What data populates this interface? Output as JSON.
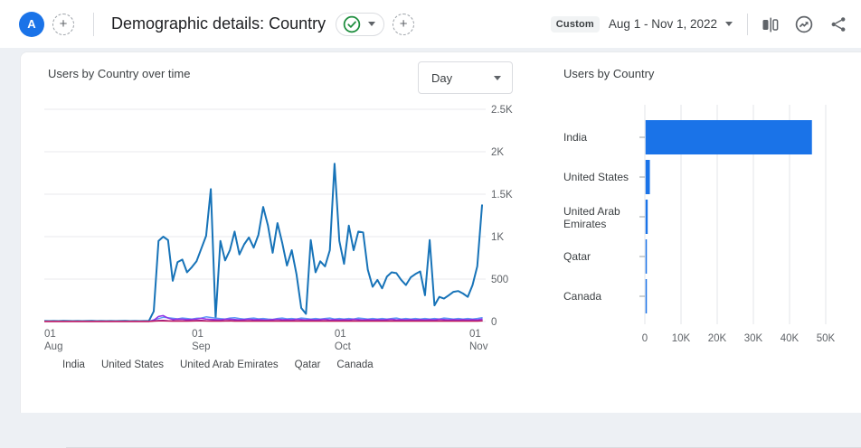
{
  "header": {
    "avatar_letter": "A",
    "add_comparison_label": "+",
    "title": "Demographic details: Country",
    "add_metric_label": "+",
    "date_range_type": "Custom",
    "date_range": "Aug 1 - Nov 1, 2022"
  },
  "left_panel": {
    "title": "Users by Country over time",
    "granularity_selected": "Day"
  },
  "right_panel": {
    "title": "Users by Country"
  },
  "colors": {
    "accent_blue": "#1a73e8",
    "check_green": "#1e8e3e",
    "grid": "#e8eaed",
    "axis_text": "#5f6368"
  },
  "chart_data": [
    {
      "type": "line",
      "title": "Users by Country over time",
      "granularity": "Day",
      "grid": true,
      "legend_position": "bottom",
      "ylim": [
        0,
        2500
      ],
      "y_ticks": [
        0,
        500,
        1000,
        1500,
        2000,
        2500
      ],
      "y_tick_labels": [
        "0",
        "500",
        "1K",
        "1.5K",
        "2K",
        "2.5K"
      ],
      "x_range": [
        "Aug 1, 2022",
        "Nov 1, 2022"
      ],
      "x_ticks": [
        {
          "day": 0,
          "top": "01",
          "bottom": "Aug"
        },
        {
          "day": 31,
          "top": "01",
          "bottom": "Sep"
        },
        {
          "day": 61,
          "top": "01",
          "bottom": "Oct"
        },
        {
          "day": 92,
          "top": "01",
          "bottom": "Nov"
        }
      ],
      "series": [
        {
          "name": "India",
          "color": "#1773b8",
          "values": [
            6,
            5,
            6,
            5,
            7,
            6,
            5,
            6,
            5,
            6,
            7,
            5,
            6,
            5,
            6,
            5,
            6,
            7,
            5,
            6,
            5,
            6,
            9,
            120,
            950,
            1000,
            960,
            480,
            700,
            730,
            580,
            640,
            710,
            860,
            1010,
            1560,
            40,
            950,
            720,
            840,
            1060,
            790,
            910,
            990,
            870,
            1020,
            1350,
            1130,
            810,
            1160,
            930,
            660,
            840,
            560,
            160,
            90,
            960,
            580,
            710,
            650,
            840,
            1860,
            950,
            680,
            1130,
            840,
            1060,
            1050,
            610,
            410,
            490,
            390,
            530,
            580,
            570,
            490,
            430,
            520,
            560,
            590,
            310,
            960,
            190,
            290,
            270,
            310,
            350,
            360,
            330,
            290,
            430,
            650,
            1370
          ]
        },
        {
          "name": "United States",
          "color": "#5e97f6",
          "values": [
            2,
            2,
            2,
            2,
            2,
            2,
            2,
            2,
            2,
            2,
            2,
            2,
            2,
            2,
            2,
            2,
            2,
            2,
            2,
            2,
            2,
            2,
            2,
            20,
            35,
            50,
            45,
            38,
            32,
            42,
            36,
            30,
            38,
            42,
            55,
            48,
            40,
            34,
            30,
            42,
            46,
            36,
            30,
            36,
            42,
            32,
            36,
            30,
            26,
            36,
            42,
            32,
            36,
            30,
            42,
            36,
            30,
            36,
            30,
            36,
            42,
            30,
            36,
            30,
            36,
            30,
            42,
            36,
            30,
            36,
            30,
            36,
            30,
            36,
            42,
            30,
            36,
            30,
            36,
            30,
            36,
            30,
            36,
            30,
            42,
            36,
            30,
            36,
            30,
            36,
            30,
            36,
            45
          ]
        },
        {
          "name": "United Arab Emirates",
          "color": "#9334e6",
          "values": [
            2,
            2,
            2,
            2,
            2,
            2,
            2,
            2,
            2,
            2,
            2,
            2,
            2,
            2,
            2,
            2,
            2,
            2,
            2,
            2,
            2,
            2,
            2,
            15,
            60,
            70,
            40,
            25,
            30,
            28,
            22,
            26,
            30,
            38,
            30,
            26,
            22,
            20,
            28,
            30,
            24,
            20,
            24,
            28,
            22,
            24,
            20,
            18,
            24,
            28,
            22,
            24,
            20,
            28,
            24,
            20,
            24,
            20,
            24,
            28,
            20,
            24,
            20,
            24,
            20,
            28,
            24,
            20,
            24,
            20,
            24,
            20,
            24,
            28,
            20,
            24,
            20,
            24,
            20,
            24,
            20,
            24,
            20,
            28,
            24,
            20,
            24,
            20,
            24,
            20,
            24,
            20,
            30
          ]
        },
        {
          "name": "Qatar",
          "color": "#7627bb",
          "values": [
            1,
            1,
            1,
            1,
            1,
            1,
            1,
            1,
            1,
            1,
            1,
            1,
            1,
            1,
            1,
            1,
            1,
            1,
            1,
            1,
            1,
            1,
            1,
            8,
            12,
            14,
            10,
            8,
            10,
            9,
            8,
            10,
            12,
            14,
            10,
            9,
            8,
            8,
            10,
            12,
            9,
            8,
            9,
            10,
            8,
            9,
            8,
            8,
            9,
            10,
            8,
            9,
            8,
            10,
            9,
            8,
            9,
            8,
            9,
            10,
            8,
            9,
            8,
            9,
            8,
            10,
            9,
            8,
            9,
            8,
            9,
            8,
            9,
            10,
            8,
            9,
            8,
            9,
            8,
            9,
            8,
            9,
            8,
            10,
            9,
            8,
            9,
            8,
            9,
            8,
            9,
            8,
            12
          ]
        },
        {
          "name": "Canada",
          "color": "#c2185b",
          "values": [
            1,
            1,
            1,
            1,
            1,
            1,
            1,
            1,
            1,
            1,
            1,
            1,
            1,
            1,
            1,
            1,
            1,
            1,
            1,
            1,
            1,
            1,
            1,
            5,
            7,
            8,
            6,
            5,
            6,
            5,
            5,
            6,
            7,
            8,
            6,
            5,
            5,
            5,
            6,
            7,
            5,
            5,
            5,
            6,
            5,
            5,
            5,
            5,
            5,
            6,
            5,
            5,
            5,
            6,
            5,
            5,
            5,
            5,
            5,
            6,
            5,
            5,
            5,
            5,
            5,
            6,
            5,
            5,
            5,
            5,
            5,
            5,
            5,
            6,
            5,
            5,
            5,
            5,
            5,
            5,
            5,
            5,
            5,
            6,
            5,
            5,
            5,
            5,
            5,
            5,
            5,
            5,
            7
          ]
        }
      ]
    },
    {
      "type": "bar",
      "orientation": "horizontal",
      "title": "Users by Country",
      "categories": [
        "India",
        "United States",
        "United Arab Emirates",
        "Qatar",
        "Canada"
      ],
      "values": [
        46000,
        1200,
        600,
        350,
        300
      ],
      "bar_color": "#1a73e8",
      "xlim": [
        0,
        50000
      ],
      "x_ticks": [
        0,
        10000,
        20000,
        30000,
        40000,
        50000
      ],
      "x_tick_labels": [
        "0",
        "10K",
        "20K",
        "30K",
        "40K",
        "50K"
      ],
      "category_wrap": {
        "United Arab Emirates": [
          "United Arab",
          "Emirates"
        ]
      }
    }
  ]
}
